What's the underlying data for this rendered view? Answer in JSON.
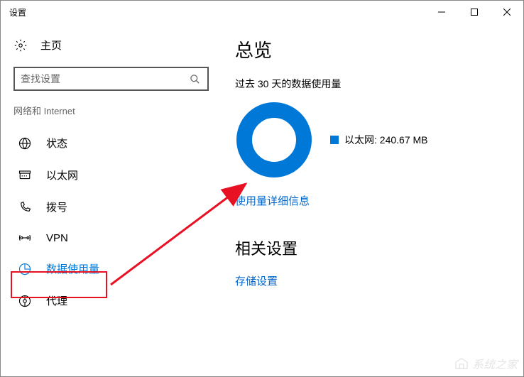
{
  "window": {
    "title": "设置"
  },
  "sidebar": {
    "home_label": "主页",
    "search_placeholder": "查找设置",
    "category": "网络和 Internet",
    "items": [
      {
        "label": "状态"
      },
      {
        "label": "以太网"
      },
      {
        "label": "拨号"
      },
      {
        "label": "VPN"
      },
      {
        "label": "数据使用量"
      },
      {
        "label": "代理"
      }
    ]
  },
  "main": {
    "title": "总览",
    "subtitle": "过去 30 天的数据使用量",
    "legend_label": "以太网: 240.67 MB",
    "details_link": "使用量详细信息",
    "related_title": "相关设置",
    "storage_link": "存储设置"
  },
  "chart_data": {
    "type": "pie",
    "title": "过去 30 天的数据使用量",
    "series": [
      {
        "name": "以太网",
        "value": 240.67,
        "unit": "MB",
        "color": "#0078d7"
      }
    ]
  },
  "watermark": "系统之家"
}
